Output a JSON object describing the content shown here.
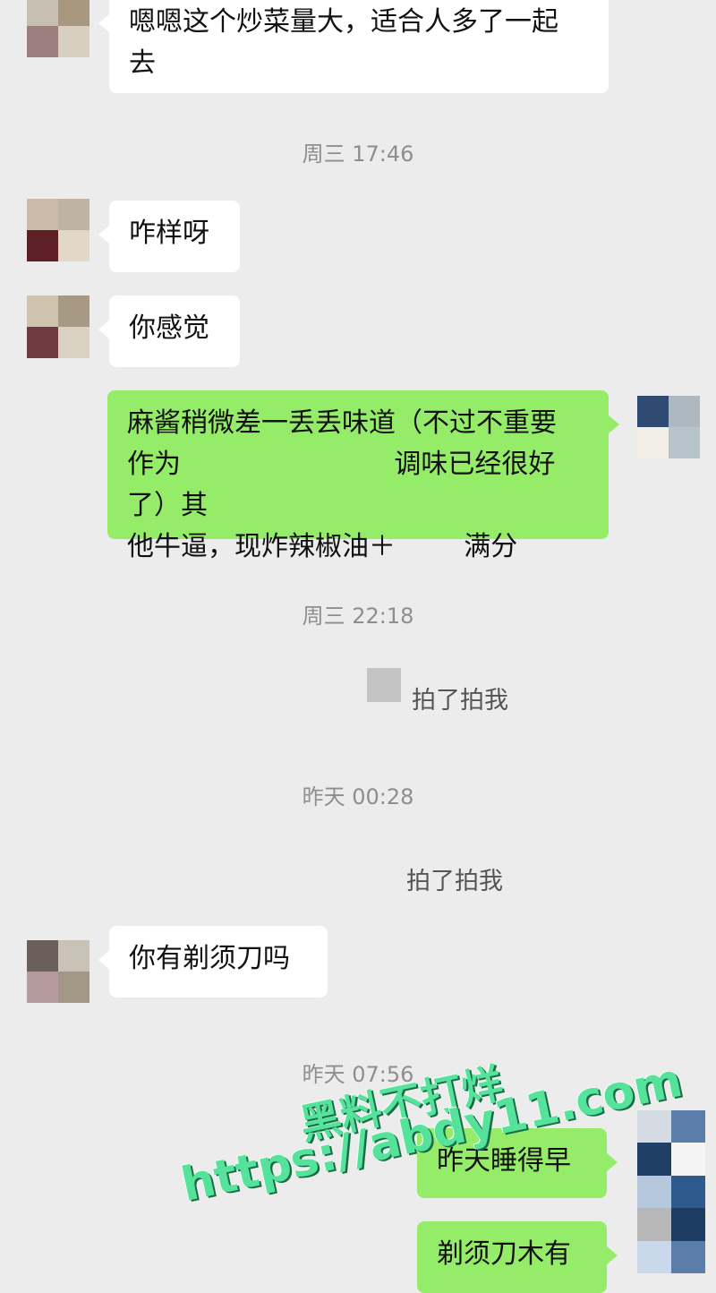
{
  "messages": [
    {
      "id": "m1",
      "side": "left",
      "text": "嗯嗯这个炒菜量大，适合人多了一起\n去"
    },
    {
      "id": "m2",
      "side": "left",
      "text": "咋样呀"
    },
    {
      "id": "m3",
      "side": "left",
      "text": "你感觉"
    },
    {
      "id": "m4",
      "side": "right",
      "text": "麻酱稍微差一丢丢味道（不过不重要\n作为                         调味已经很好了）其\n他牛逼，现炸辣椒油＋        满分"
    },
    {
      "id": "m5",
      "side": "left",
      "text": "你有剃须刀吗"
    },
    {
      "id": "m6",
      "side": "right",
      "text": "昨天睡得早"
    },
    {
      "id": "m7",
      "side": "right",
      "text": "剃须刀木有"
    }
  ],
  "timestamps": [
    "周三 17:46",
    "周三 22:18",
    "昨天 00:28",
    "昨天 07:56"
  ],
  "system_notices": [
    "拍了拍我",
    "拍了拍我"
  ],
  "watermark": {
    "line1": "黑料不打烊",
    "line2": "https://abdy11.com"
  },
  "colors": {
    "background": "#ececec",
    "bubble_self": "#95ec69",
    "bubble_other": "#ffffff",
    "timestamp": "#8e8e8e",
    "watermark": "#55e39b"
  }
}
